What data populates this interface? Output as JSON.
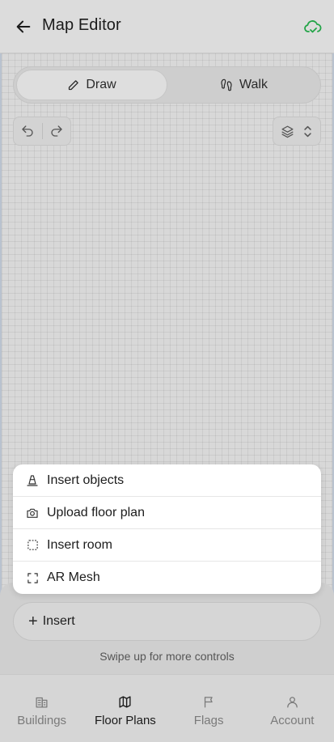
{
  "header": {
    "title": "Map Editor",
    "back_icon": "arrow-left-icon",
    "sync_icon": "cloud-check-icon",
    "sync_color": "#22a447"
  },
  "mode_toggle": {
    "draw_label": "Draw",
    "walk_label": "Walk",
    "selected": "Draw"
  },
  "toolbar": {
    "undo_icon": "undo-icon",
    "redo_icon": "redo-icon",
    "layers_icon": "layers-icon"
  },
  "insert_menu": {
    "items": [
      {
        "label": "Insert objects",
        "icon": "cone-icon"
      },
      {
        "label": "Upload floor plan",
        "icon": "camera-icon"
      },
      {
        "label": "Insert room",
        "icon": "dashed-square-icon"
      },
      {
        "label": "AR Mesh",
        "icon": "scan-frame-icon"
      }
    ]
  },
  "bottom_sheet": {
    "insert_label": "Insert",
    "hint": "Swipe up for more controls"
  },
  "tabs": [
    {
      "label": "Buildings",
      "icon": "building-icon",
      "active": false
    },
    {
      "label": "Floor Plans",
      "icon": "map-icon",
      "active": true
    },
    {
      "label": "Flags",
      "icon": "flag-icon",
      "active": false
    },
    {
      "label": "Account",
      "icon": "user-icon",
      "active": false
    }
  ]
}
